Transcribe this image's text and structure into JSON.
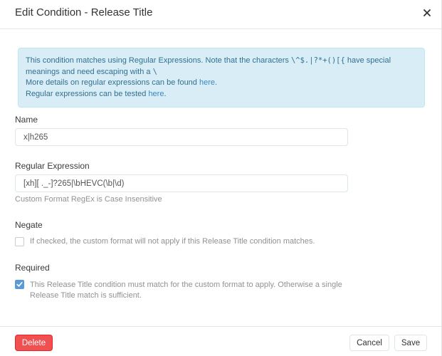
{
  "modal": {
    "title": "Edit Condition - Release Title"
  },
  "info": {
    "line1_pre": "This condition matches using Regular Expressions. Note that the characters ",
    "special_chars": "\\^$.|?*+()[{",
    "line1_post": " have special meanings and need escaping with a ",
    "escape_char": "\\",
    "line2_pre": "More details on regular expressions can be found ",
    "line2_link": "here",
    "line2_post": ".",
    "line3_pre": "Regular expressions can be tested ",
    "line3_link": "here",
    "line3_post": "."
  },
  "name": {
    "label": "Name",
    "value": "x|h265"
  },
  "regex": {
    "label": "Regular Expression",
    "value": "[xh][ ._-]?265|\\bHEVC(\\b|\\d)",
    "help": "Custom Format RegEx is Case Insensitive"
  },
  "negate": {
    "label": "Negate",
    "checked": false,
    "text": "If checked, the custom format will not apply if this Release Title condition matches."
  },
  "required": {
    "label": "Required",
    "checked": true,
    "text": "This Release Title condition must match for the custom format to apply. Otherwise a single Release Title match is sufficient."
  },
  "footer": {
    "delete_label": "Delete",
    "cancel_label": "Cancel",
    "save_label": "Save"
  },
  "colors": {
    "info_bg": "#d9edf7",
    "info_text": "#31708f",
    "danger": "#f05050",
    "checkbox_on": "#5b9bd5"
  },
  "icons": {
    "close": "close-icon",
    "check": "check-icon"
  }
}
